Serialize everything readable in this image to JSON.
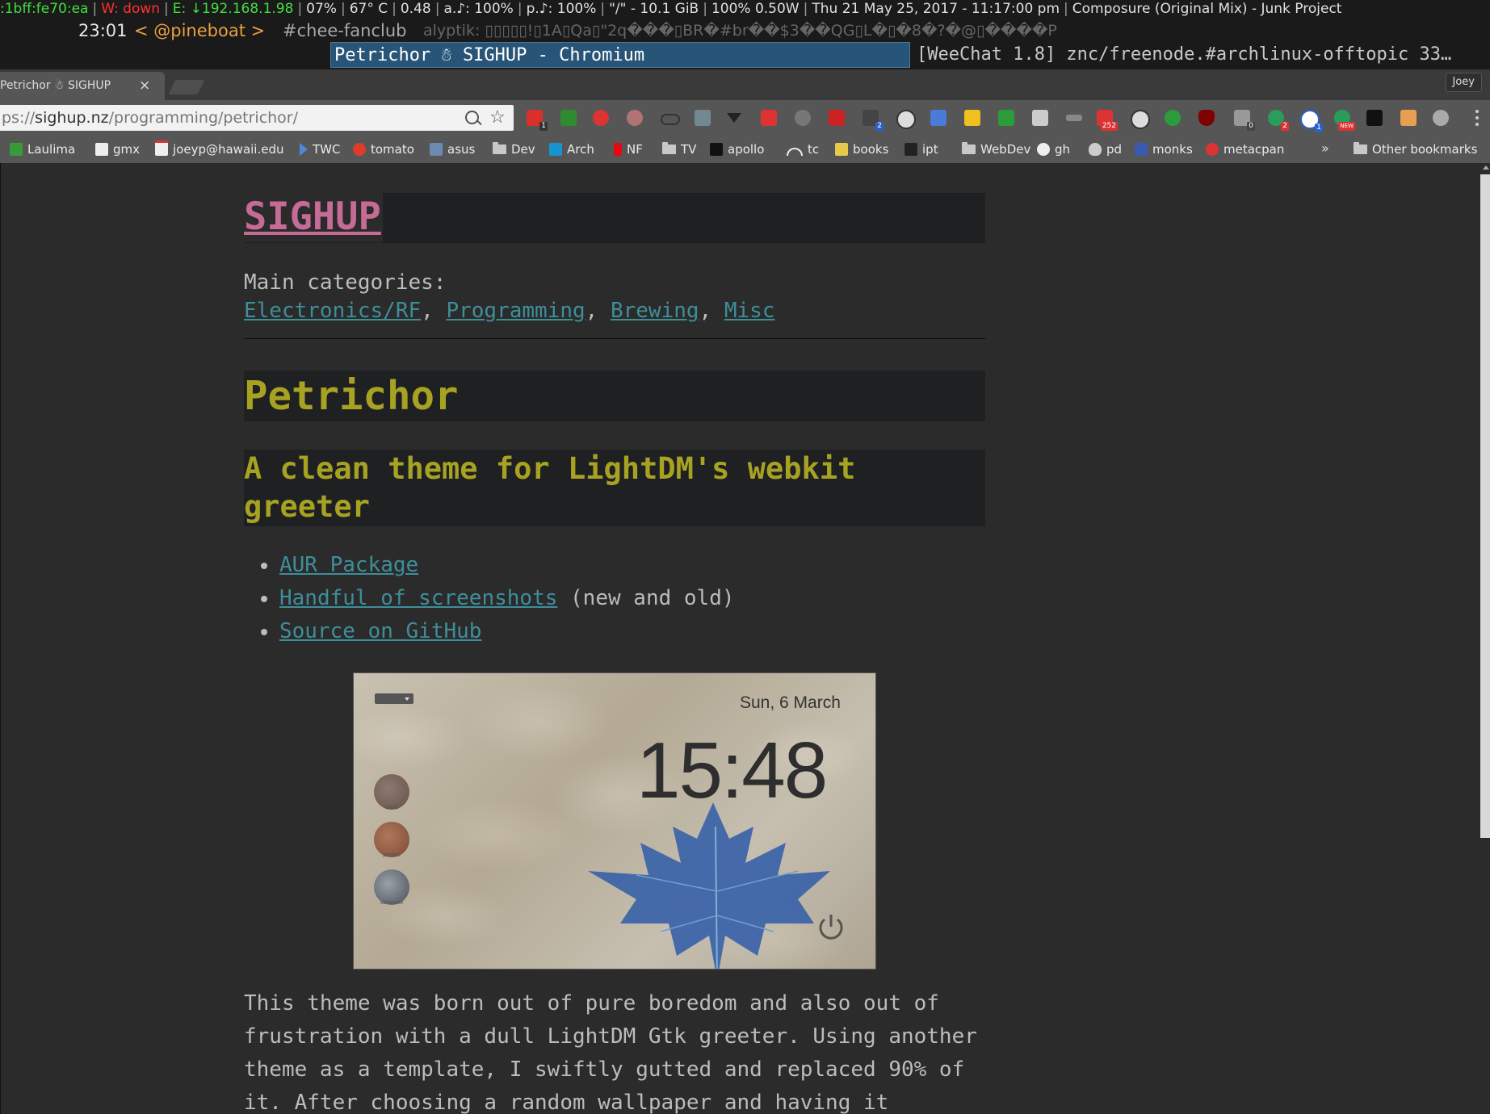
{
  "status_bar": {
    "ipv6": ":1bff:fe70:ea",
    "wifi": "W: down",
    "ethernet": "E: ↓192.168.1.98",
    "battery": "07%",
    "temp": "67° C",
    "load": "0.48",
    "audio_a": "a.♪: 100%",
    "audio_p": "p.♪: 100%",
    "disk": "\"/\" - 10.1 GiB",
    "power": "100% 0.50W",
    "datetime": "Thu 21 May 25, 2017 - 11:17:00 pm",
    "now_playing": "Composure (Original Mix) - Junk Project"
  },
  "irc": {
    "time": "23:01",
    "nick": "< @pineboat >",
    "channel": "#chee-fanclub",
    "message": "alyptik: ▯▯▯▯▯!▯1A▯Qa▯\"2q���▯BR�#br��$3��QG▯L�▯�8�?�@▯����P"
  },
  "windows": {
    "active": "Petrichor ☃ SIGHUP - Chromium",
    "inactive": "[WeeChat 1.8] znc/freenode.#archlinux-offtopic 33…"
  },
  "browser": {
    "tab_title": "Petrichor ☃ SIGHUP",
    "tab_close": "×",
    "profile": "Joey",
    "url_scheme": "ps://",
    "url_host": "sighup.nz",
    "url_path": "/programming/petrichor/",
    "star": "☆",
    "bookmarks_more": "»",
    "bookmarks": [
      "Laulima",
      "gmx",
      "joeyp@hawaii.edu",
      "TWC",
      "tomato",
      "asus",
      "Dev",
      "Arch",
      "NF",
      "TV",
      "apollo",
      "tc",
      "books",
      "ipt",
      "WebDev",
      "gh",
      "pd",
      "monks",
      "metacpan",
      "Other bookmarks"
    ],
    "extension_badges": [
      "1",
      "2",
      "252",
      "0",
      "2",
      "1",
      "NEW"
    ]
  },
  "page": {
    "site_title": "SIGHUP",
    "categories_label": "Main categories:",
    "categories": [
      "Electronics/RF",
      "Programming",
      "Brewing",
      "Misc"
    ],
    "separator": ", ",
    "heading": "Petrichor",
    "subheading": "A clean theme for LightDM's webkit greeter",
    "links": [
      {
        "text": "AUR Package",
        "suffix": ""
      },
      {
        "text": "Handful of screenshots",
        "suffix": " (new and old)"
      },
      {
        "text": "Source on GitHub",
        "suffix": ""
      }
    ],
    "screenshot": {
      "date": "Sun, 6 March",
      "clock": "15:48",
      "users": [
        "david",
        "person",
        "someone"
      ]
    },
    "paragraph": "This theme was born out of pure boredom and also out of frustration with a dull LightDM Gtk greeter. Using another theme as a template, I swiftly gutted and replaced 90% of it. After choosing a random wallpaper and having it"
  },
  "colors": {
    "link": "#3e8e9a",
    "site_title": "#c56b96",
    "heading": "#a8a222",
    "text": "#bcbcbc",
    "background": "#2b2b2b"
  }
}
